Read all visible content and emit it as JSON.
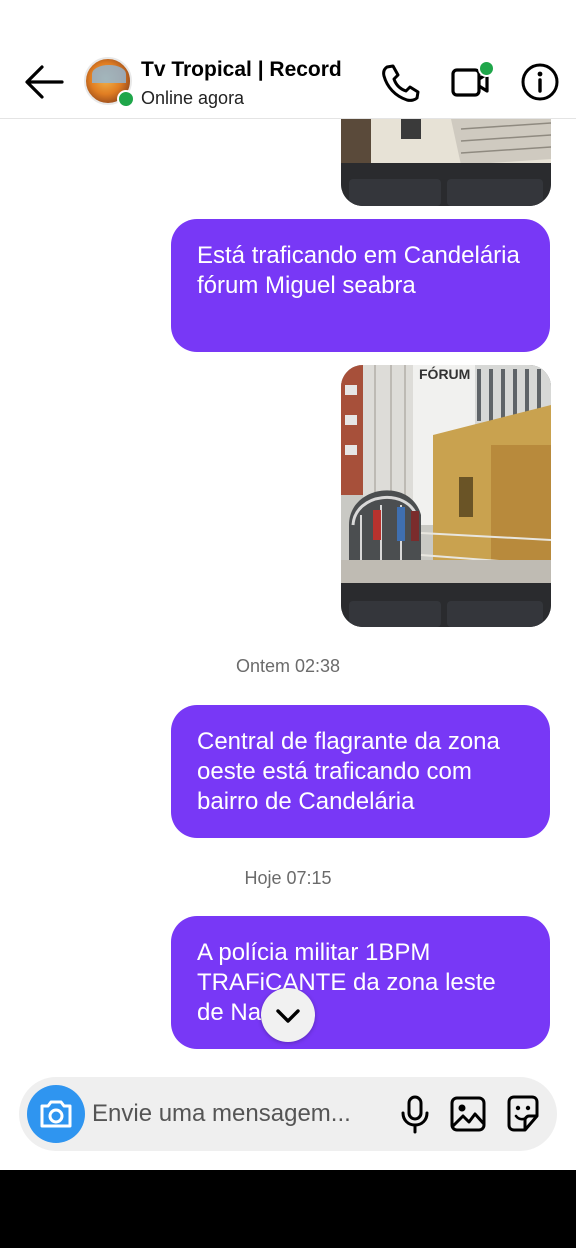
{
  "header": {
    "name": "Tv Tropical | Record",
    "status": "Online agora",
    "colors": {
      "online": "#1fa64a"
    },
    "icons": [
      "back-arrow-icon",
      "phone-icon",
      "video-camera-icon",
      "info-icon"
    ]
  },
  "messages": [
    {
      "type": "text",
      "text": "Está traficando em Candelária fórum Miguel seabra"
    },
    {
      "type": "text",
      "text": "Central de flagrante da zona oeste está traficando com bairro de Candelária"
    },
    {
      "type": "text",
      "text": "A polícia militar 1BPM TRAFiCANTE da zona leste de Na"
    }
  ],
  "timestamps": [
    "Ontem 02:38",
    "Hoje 07:15"
  ],
  "photo": {
    "sign_text": "FÓRUM"
  },
  "composer": {
    "placeholder": "Envie uma mensagem...",
    "icons": [
      "camera-icon",
      "microphone-icon",
      "gallery-icon",
      "sticker-icon"
    ]
  },
  "colors": {
    "bubble": "#7838f6",
    "camera": "#2f95f0"
  }
}
